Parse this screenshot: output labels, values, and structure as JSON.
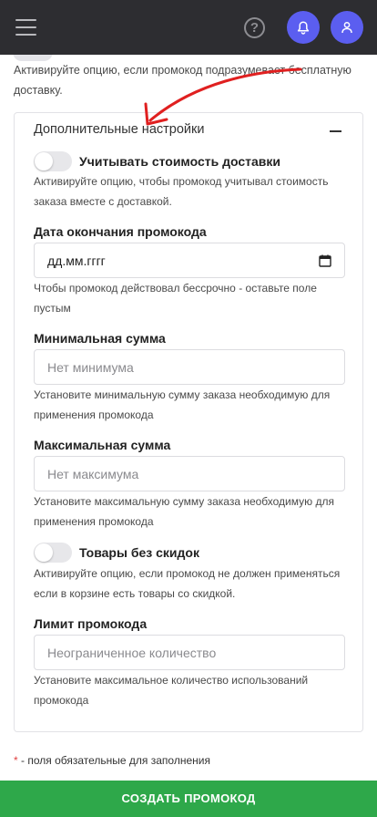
{
  "header": {
    "menu_icon": "hamburger-icon",
    "help_icon": "question-icon",
    "help_glyph": "?",
    "notifications_icon": "bell-icon",
    "profile_icon": "user-icon",
    "bg_color": "#2d2d31",
    "accent_color": "#5b5ef0"
  },
  "free_shipping": {
    "hint": "Активируйте опцию, если промокод подразумевает бесплатную доставку."
  },
  "additional": {
    "title": "Дополнительные настройки",
    "collapse_icon": "minus-icon",
    "include_shipping": {
      "label": "Учитывать стоимость доставки",
      "enabled": false,
      "hint": "Активируйте опцию, чтобы промокод учитывал стоимость заказа вместе с доставкой."
    },
    "end_date": {
      "label": "Дата окончания промокода",
      "placeholder": "дд.мм.гггг",
      "icon": "calendar-icon",
      "hint": "Чтобы промокод действовал бессрочно - оставьте поле пустым"
    },
    "min_sum": {
      "label": "Минимальная сумма",
      "placeholder": "Нет минимума",
      "hint": "Установите минимальную сумму заказа необходимую для применения промокода"
    },
    "max_sum": {
      "label": "Максимальная сумма",
      "placeholder": "Нет максимума",
      "hint": "Установите максимальную сумму заказа необходимую для применения промокода"
    },
    "no_discount_items": {
      "label": "Товары без скидок",
      "enabled": false,
      "hint": "Активируйте опцию, если промокод не должен применяться если в корзине есть товары со скидкой."
    },
    "limit": {
      "label": "Лимит промокода",
      "placeholder": "Неограниченное количество",
      "hint": "Установите максимальное количество использований промокода"
    }
  },
  "footer": {
    "required_star": "*",
    "required_note": " - поля обязательные для заполнения",
    "submit_label": "СОЗДАТЬ ПРОМОКОД",
    "submit_color": "#2ea84a"
  },
  "annotation": {
    "arrow_color": "#e02020"
  }
}
